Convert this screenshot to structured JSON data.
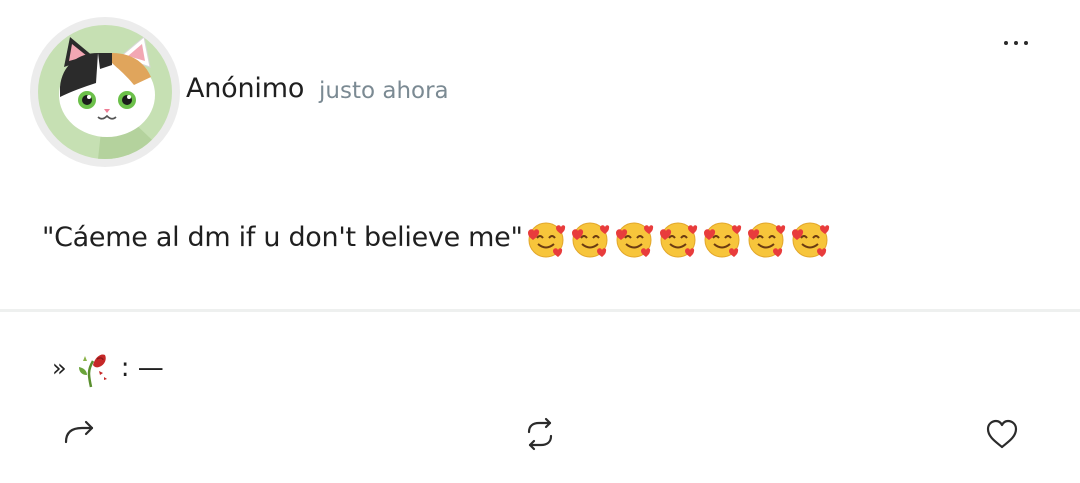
{
  "post": {
    "author": "Anónimo",
    "timestamp": "justo ahora",
    "message": "\"Cáeme al dm if u don't believe me\"",
    "emoji_count": 7,
    "emoji_icon": "smiling-face-with-hearts-emoji",
    "reply_prefix": "»",
    "reply_text": ": —"
  },
  "icons": {
    "more": "more-options-icon",
    "share": "share-arrow-icon",
    "repost": "repost-icon",
    "like": "heart-icon",
    "rose": "wilted-flower-emoji"
  },
  "colors": {
    "avatar_bg": "#c6e0b3",
    "avatar_ring": "#ececec",
    "timestamp": "#7b8a93",
    "divider": "#eef0ef"
  }
}
